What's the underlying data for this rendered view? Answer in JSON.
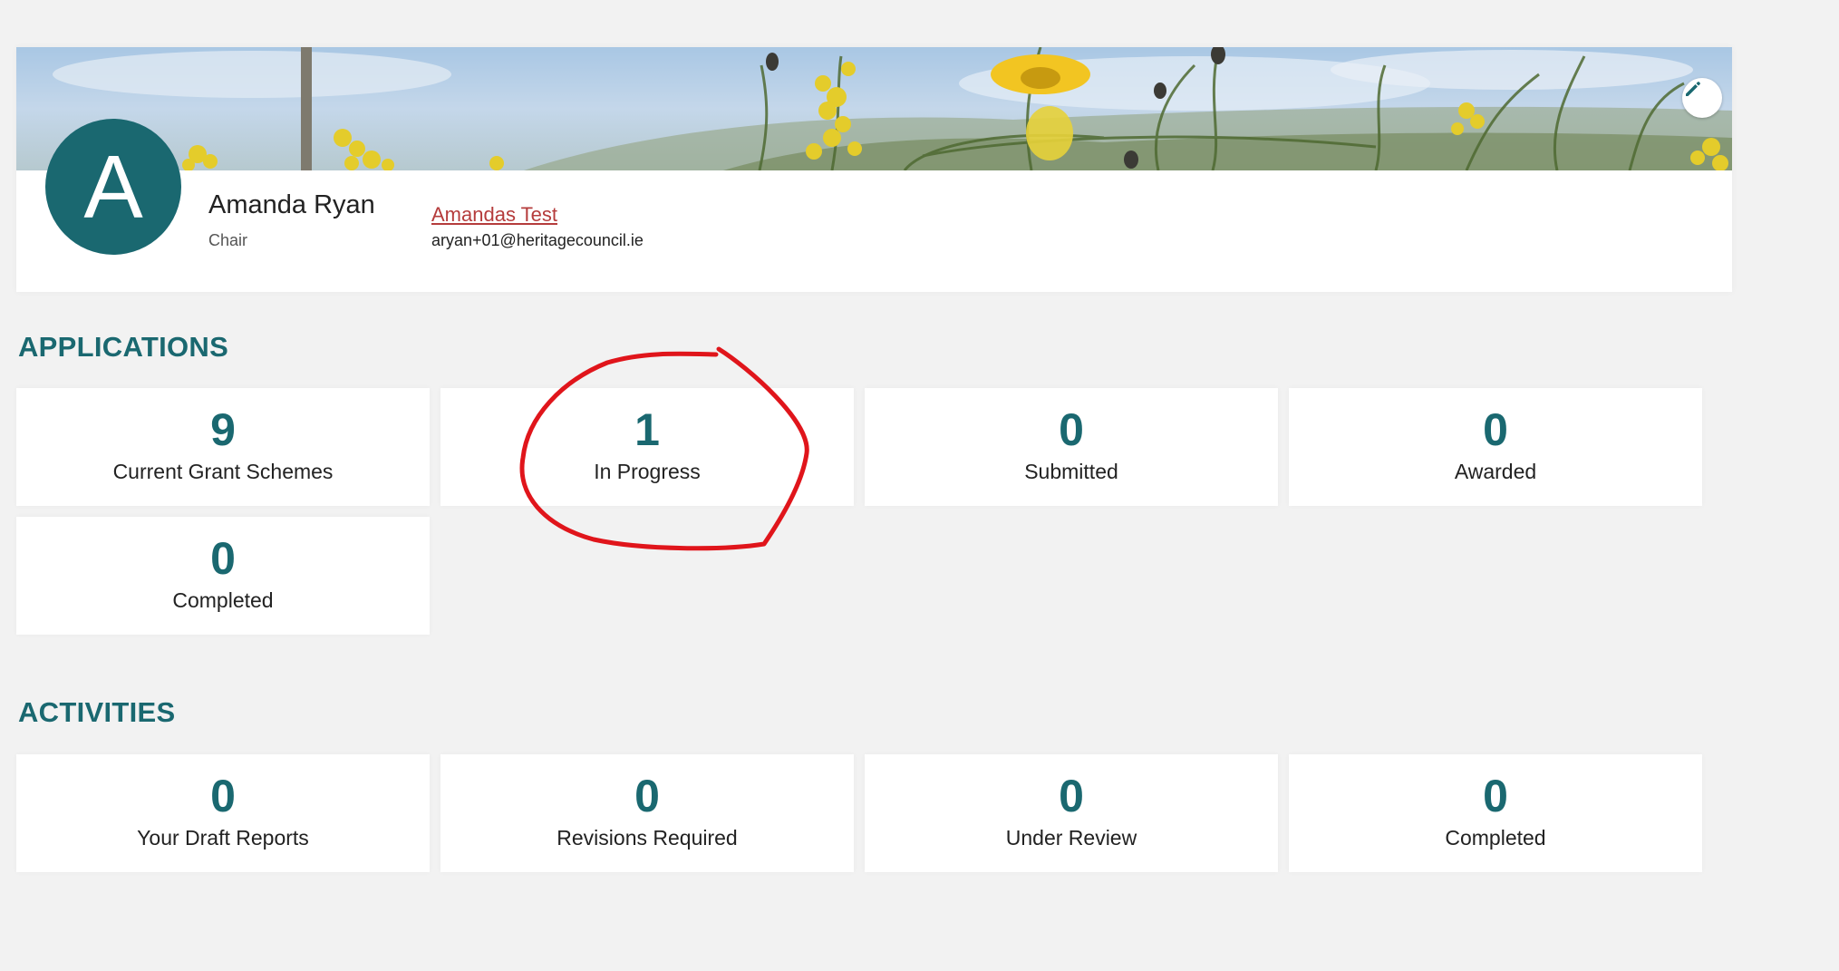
{
  "profile": {
    "avatar_letter": "A",
    "name": "Amanda Ryan",
    "role": "Chair",
    "organisation": "Amandas Test",
    "email": "aryan+01@heritagecouncil.ie"
  },
  "applications": {
    "heading": "APPLICATIONS",
    "tiles": [
      {
        "value": "9",
        "label": "Current Grant Schemes"
      },
      {
        "value": "1",
        "label": "In Progress"
      },
      {
        "value": "0",
        "label": "Submitted"
      },
      {
        "value": "0",
        "label": "Awarded"
      },
      {
        "value": "0",
        "label": "Completed"
      }
    ]
  },
  "activities": {
    "heading": "ACTIVITIES",
    "tiles": [
      {
        "value": "0",
        "label": "Your Draft Reports"
      },
      {
        "value": "0",
        "label": "Revisions Required"
      },
      {
        "value": "0",
        "label": "Under Review"
      },
      {
        "value": "0",
        "label": "Completed"
      }
    ]
  },
  "icons": {
    "edit": "pencil-icon"
  },
  "colors": {
    "accent": "#1a6870",
    "link": "#b53c3c",
    "annotation": "#e0151b",
    "background": "#f2f2f2"
  }
}
